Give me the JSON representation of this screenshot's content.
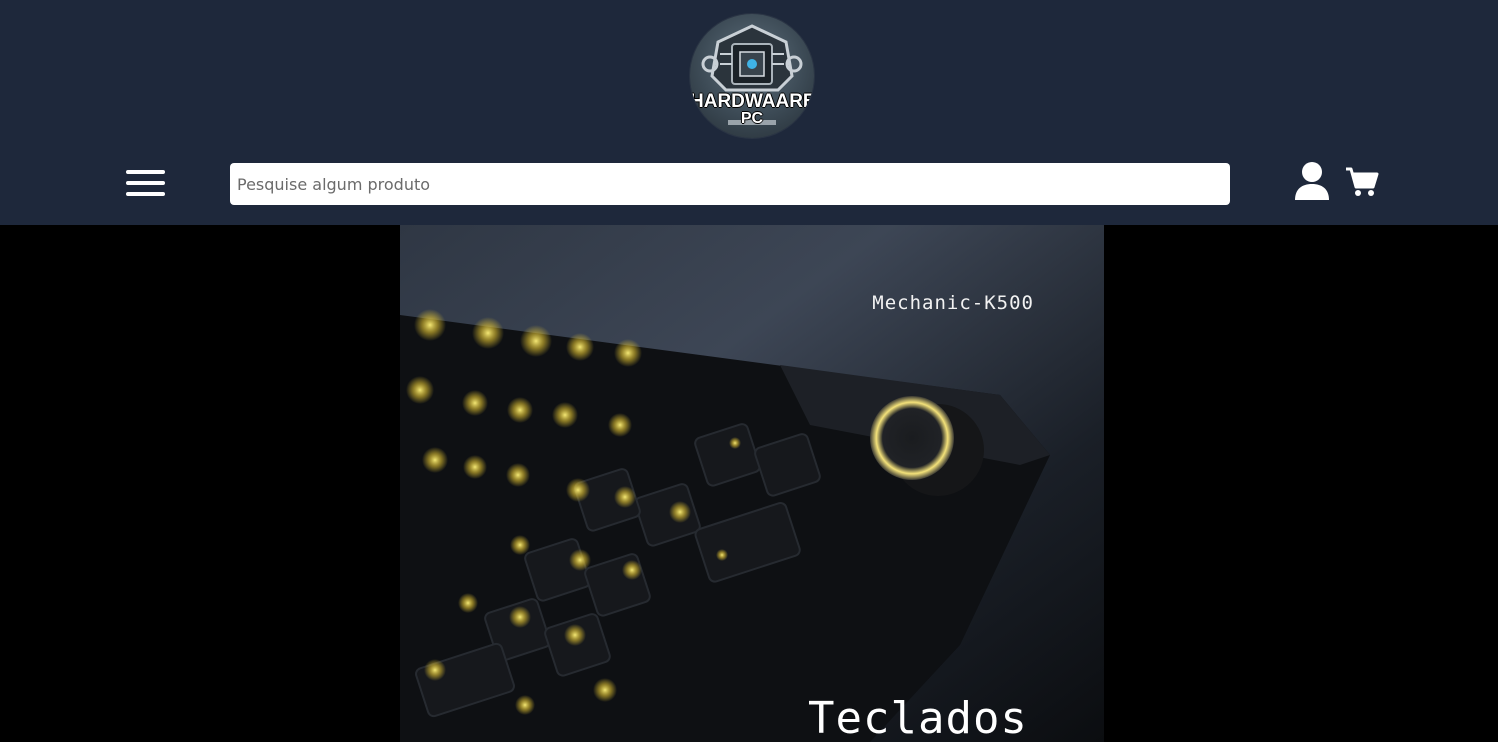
{
  "header": {
    "logo": {
      "name": "hardwaare-pc-logo",
      "line1": "HARDWAARE",
      "line2": "PC"
    },
    "menu_icon": "hamburger-menu-icon",
    "search": {
      "placeholder": "Pesquise algum produto",
      "value": ""
    },
    "user_icon": "user-icon",
    "cart_icon": "shopping-cart-icon"
  },
  "banner": {
    "product_label": "Mechanic-K500",
    "category_title": "Teclados"
  },
  "colors": {
    "header_bg": "#1e283b",
    "page_bg": "#000000",
    "key_glow": "#e8d44a"
  }
}
